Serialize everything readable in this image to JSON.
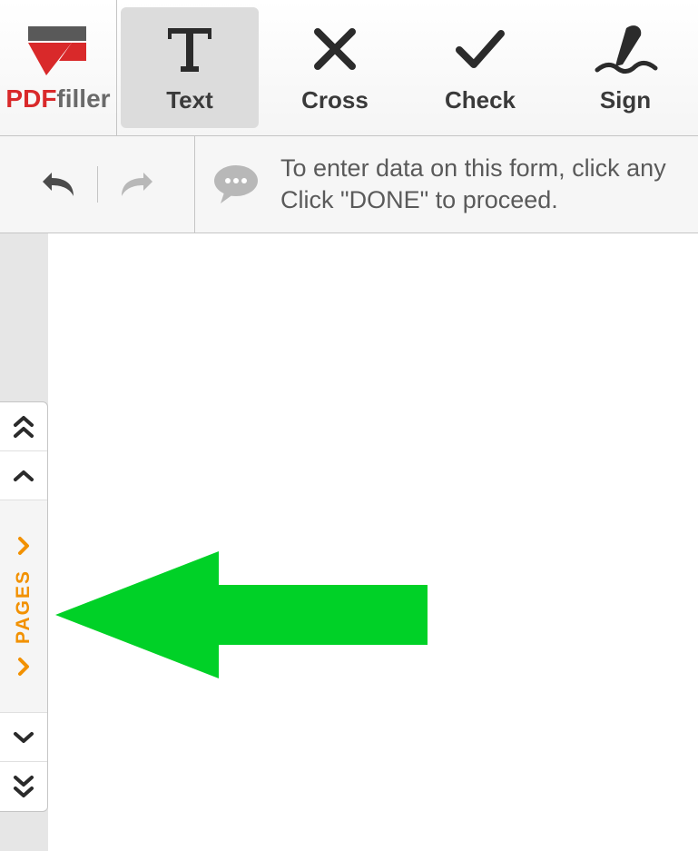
{
  "logo": {
    "pdf": "PDF",
    "filler": "filler"
  },
  "toolbar": {
    "text": "Text",
    "cross": "Cross",
    "check": "Check",
    "sign": "Sign"
  },
  "message": {
    "line1": "To enter data on this form, click any",
    "line2": "Click \"DONE\" to proceed."
  },
  "sidebar": {
    "pages_label": "PAGES"
  }
}
